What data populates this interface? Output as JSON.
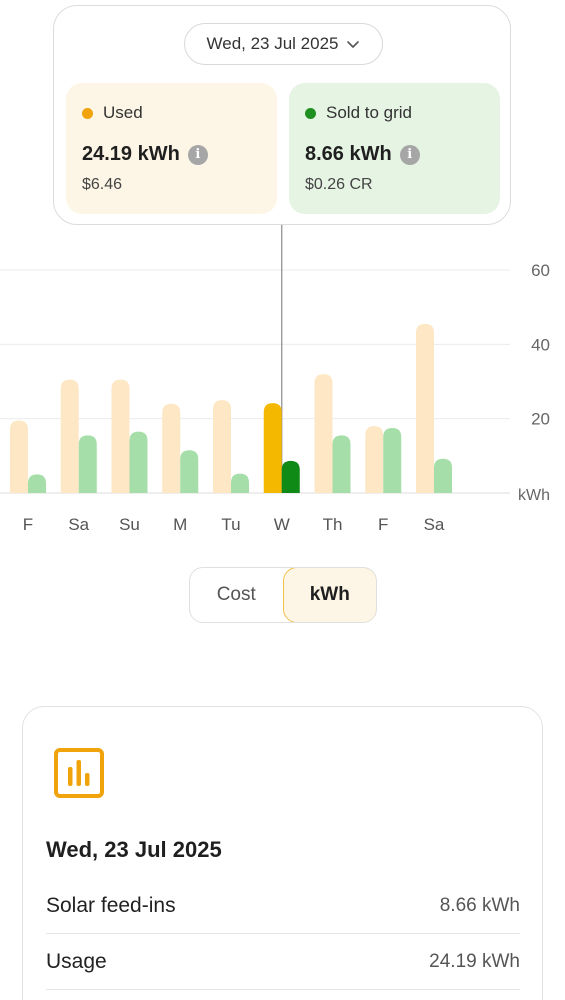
{
  "tooltip": {
    "date": "Wed, 23 Jul 2025",
    "used": {
      "label": "Used",
      "value": "24.19 kWh",
      "money": "$6.46",
      "color": "#f0a30a"
    },
    "sold": {
      "label": "Sold to grid",
      "value": "8.66 kWh",
      "money": "$0.26 CR",
      "color": "#1f8f1f"
    },
    "info_icon": "info-icon"
  },
  "chart_data": {
    "type": "bar",
    "categories": [
      "F",
      "Sa",
      "Su",
      "M",
      "Tu",
      "W",
      "Th",
      "F",
      "Sa"
    ],
    "series": [
      {
        "name": "Used",
        "values": [
          19.5,
          30.5,
          30.5,
          24,
          25,
          24.19,
          32,
          18,
          45.5
        ]
      },
      {
        "name": "Sold to grid",
        "values": [
          5,
          15.5,
          16.5,
          11.5,
          5.2,
          8.66,
          15.5,
          17.5,
          9.2
        ]
      }
    ],
    "selected_index": 5,
    "ylim": [
      0,
      60
    ],
    "yticks": [
      20,
      40,
      60
    ],
    "yunit": "kWh",
    "colors": {
      "used": "#fde7c4",
      "sold": "#a6dea9",
      "used_selected": "#f5b800",
      "sold_selected": "#0f8a16"
    }
  },
  "toggle": {
    "options": [
      "Cost",
      "kWh"
    ],
    "active": "kWh"
  },
  "detail": {
    "icon": "bar-chart-icon",
    "date": "Wed, 23 Jul 2025",
    "rows": [
      {
        "label": "Solar feed-ins",
        "value": "8.66 kWh"
      },
      {
        "label": "Usage",
        "value": "24.19 kWh"
      }
    ]
  }
}
